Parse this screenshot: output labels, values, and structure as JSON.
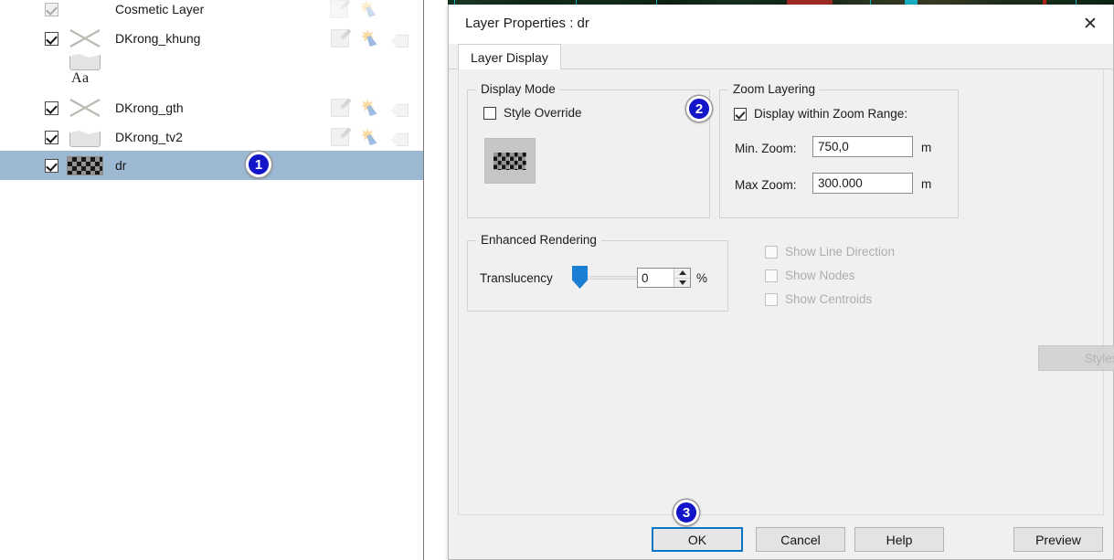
{
  "window": {
    "dialog_title": "Layer Properties  : dr",
    "close_icon": "close-icon"
  },
  "layer_panel": {
    "rows": [
      {
        "name": "Cosmetic Layer",
        "checked": true,
        "checkbox_disabled": true,
        "symbol": "none",
        "icons": [
          {
            "name": "edit-icon",
            "faded": true
          },
          {
            "name": "select-icon",
            "faded": true
          }
        ]
      },
      {
        "name": "DKrong_khung",
        "checked": true,
        "checkbox_disabled": false,
        "symbol": "line",
        "icons": [
          {
            "name": "edit-icon",
            "faded": false
          },
          {
            "name": "select-icon",
            "faded": false
          },
          {
            "name": "label-icon",
            "faded": false
          }
        ]
      },
      {
        "name": "",
        "checked": null,
        "checkbox_disabled": false,
        "symbol": "polygon",
        "icons": []
      },
      {
        "name": "",
        "checked": null,
        "checkbox_disabled": false,
        "symbol": "text",
        "symbol_text": "Aa",
        "icons": []
      },
      {
        "name": "DKrong_gth",
        "checked": true,
        "checkbox_disabled": false,
        "symbol": "line",
        "icons": [
          {
            "name": "edit-icon",
            "faded": false
          },
          {
            "name": "select-icon",
            "faded": false
          },
          {
            "name": "label-icon",
            "faded": false
          }
        ]
      },
      {
        "name": "DKrong_tv2",
        "checked": true,
        "checkbox_disabled": false,
        "symbol": "polygon",
        "icons": [
          {
            "name": "edit-icon",
            "faded": false
          },
          {
            "name": "select-icon",
            "faded": false
          },
          {
            "name": "label-icon",
            "faded": false
          }
        ]
      },
      {
        "name": "dr",
        "checked": true,
        "checkbox_disabled": false,
        "symbol": "raster",
        "selected": true,
        "icons": []
      }
    ]
  },
  "tabs": {
    "layer_display": "Layer Display"
  },
  "display_mode": {
    "group_label": "Display Mode",
    "style_override_label": "Style Override",
    "style_override_checked": false
  },
  "zoom_layering": {
    "group_label": "Zoom Layering",
    "display_within_label": "Display within Zoom Range:",
    "display_within_checked": true,
    "min_zoom_label": "Min. Zoom:",
    "min_zoom_value": "750,0",
    "min_zoom_unit": "m",
    "max_zoom_label": "Max Zoom:",
    "max_zoom_value": "300.000",
    "max_zoom_unit": "m"
  },
  "enhanced_rendering": {
    "group_label": "Enhanced Rendering",
    "translucency_label": "Translucency",
    "translucency_value": "0",
    "translucency_unit": "%",
    "slider_percent": 0
  },
  "render_options": [
    {
      "label": "Show Line Direction",
      "checked": false,
      "disabled": true
    },
    {
      "label": "Show Nodes",
      "checked": false,
      "disabled": true
    },
    {
      "label": "Show Centroids",
      "checked": false,
      "disabled": true
    }
  ],
  "styles_button": {
    "label": "Styles for New Objects ...",
    "disabled": true
  },
  "footer": {
    "ok": "OK",
    "cancel": "Cancel",
    "help": "Help",
    "preview": "Preview"
  },
  "callouts": [
    {
      "number": "1"
    },
    {
      "number": "2"
    },
    {
      "number": "3"
    }
  ],
  "colors": {
    "selection_blue": "#9db8d2",
    "badge_blue": "#1414c8",
    "focus_blue": "#0b76c8",
    "slider_blue": "#1a7fd4",
    "dialog_bg": "#f0f0f0"
  }
}
